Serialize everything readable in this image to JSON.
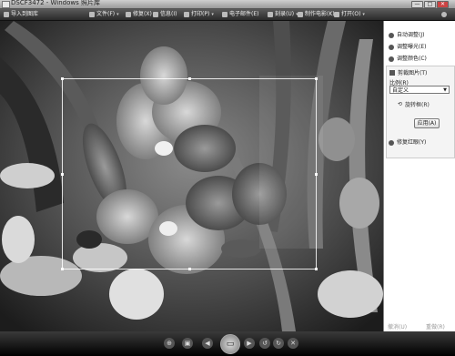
{
  "window": {
    "title": "DSCF3472 - Windows 照片库",
    "min_label": "—",
    "max_label": "□",
    "close_label": "✕"
  },
  "menubar": {
    "items": [
      {
        "label": "导入到图库",
        "icon": "import-icon"
      },
      {
        "label": "文件(F)",
        "icon": "file-icon"
      },
      {
        "label": "修复(X)",
        "icon": "fix-icon"
      },
      {
        "label": "信息(I)",
        "icon": "info-icon"
      },
      {
        "label": "打印(P)",
        "icon": "print-icon"
      },
      {
        "label": "电子邮件(E)",
        "icon": "email-icon"
      },
      {
        "label": "刻录(U)",
        "icon": "burn-icon"
      },
      {
        "label": "制作电影(K)",
        "icon": "movie-icon"
      },
      {
        "label": "打开(O)",
        "icon": "open-icon"
      },
      {
        "label": "?",
        "icon": "help-icon"
      }
    ]
  },
  "panel": {
    "auto_adjust": "自动调整(J)",
    "exposure": "调整曝光(E)",
    "color": "调整颜色(C)",
    "crop_title": "剪裁图片(T)",
    "ratio_label": "比例(R)",
    "ratio_value": "自定义",
    "rotate_label": "旋转框(R)",
    "apply": "应用(A)",
    "redeye": "修复红眼(Y)",
    "undo": "撤消(U)",
    "redo": "重做(R)"
  },
  "controls": {
    "center_label": "▭"
  },
  "colors": {
    "panel_bg": "#ffffff",
    "menubar_bg": "#3a3a3a",
    "crop_border": "#ffffff"
  }
}
